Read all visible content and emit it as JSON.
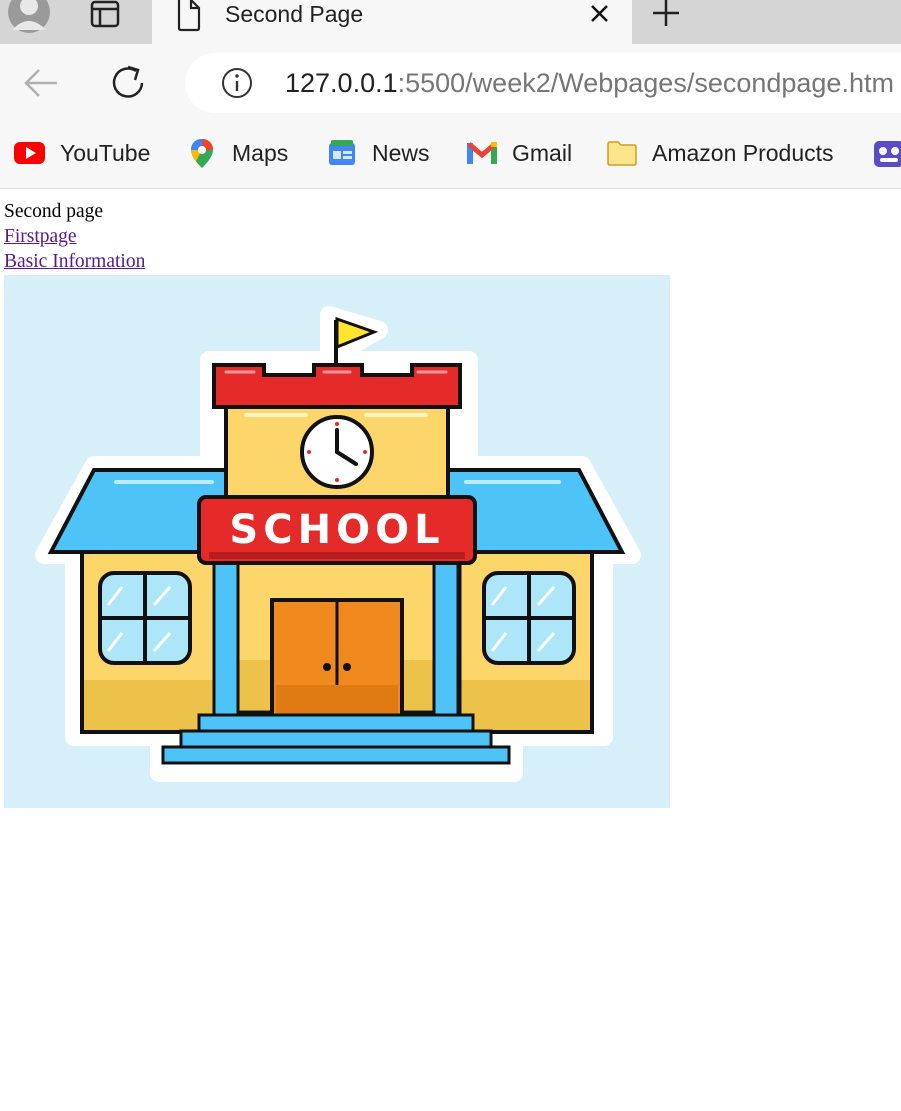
{
  "browser": {
    "tab": {
      "title": "Second Page",
      "close_icon": "close-icon"
    },
    "new_tab_icon": "plus-icon",
    "address_bar": {
      "host": "127.0.0.1",
      "path": ":5500/week2/Webpages/secondpage.htm"
    },
    "bookmarks": [
      {
        "label": "YouTube",
        "icon": "youtube-icon"
      },
      {
        "label": "Maps",
        "icon": "maps-icon"
      },
      {
        "label": "News",
        "icon": "news-icon"
      },
      {
        "label": "Gmail",
        "icon": "gmail-icon"
      },
      {
        "label": "Amazon Products",
        "icon": "folder-icon"
      }
    ]
  },
  "page": {
    "heading_text": "Second page",
    "links": [
      {
        "label": "Firstpage"
      },
      {
        "label": "Basic Information"
      }
    ],
    "image": {
      "sign_text": "SCHOOL",
      "background": "#d6eff9"
    }
  }
}
